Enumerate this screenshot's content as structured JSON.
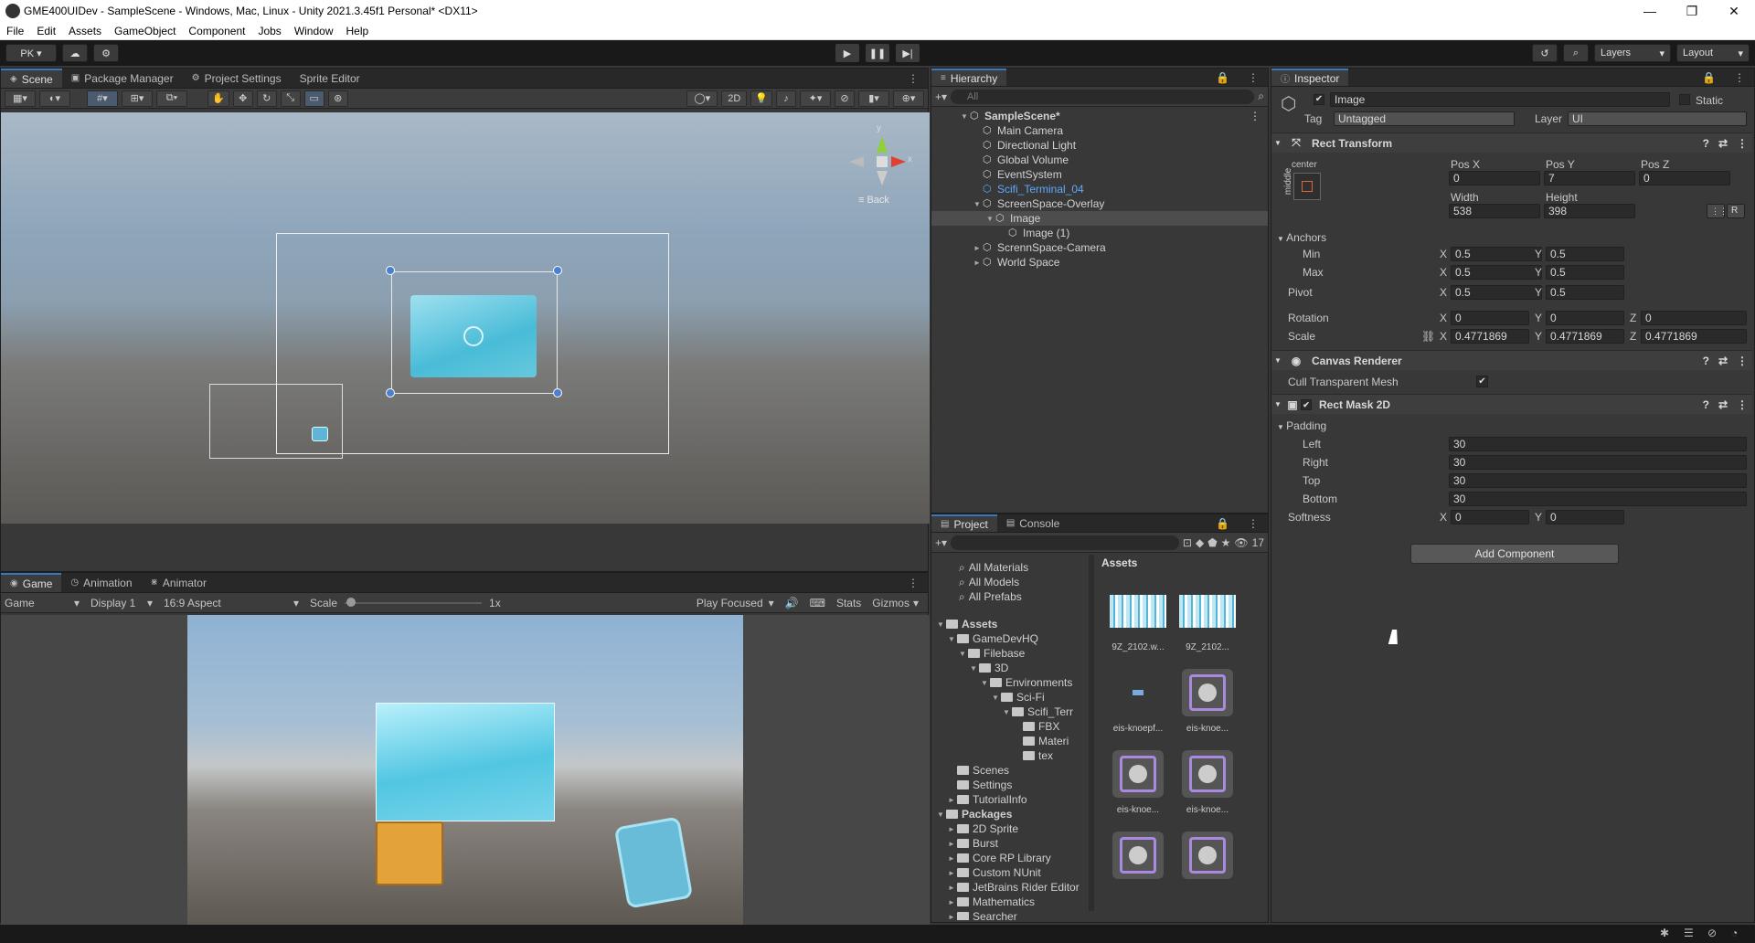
{
  "window": {
    "title": "GME400UIDev - SampleScene - Windows, Mac, Linux - Unity 2021.3.45f1 Personal* <DX11>",
    "minimize": "—",
    "maximize": "❐",
    "close": "✕"
  },
  "menu": [
    "File",
    "Edit",
    "Assets",
    "GameObject",
    "Component",
    "Jobs",
    "Window",
    "Help"
  ],
  "toolbar": {
    "account": "PK ▾",
    "play_icon": "play-icon",
    "layers": "Layers",
    "layout": "Layout"
  },
  "scene_tabs": {
    "scene": "Scene",
    "package_manager": "Package Manager",
    "project_settings": "Project Settings",
    "sprite_editor": "Sprite Editor"
  },
  "scene_toolbar": {
    "mode_2d": "2D"
  },
  "gizmo": {
    "y": "y",
    "x": "x",
    "back": "≡ Back"
  },
  "game_tabs": {
    "game": "Game",
    "animation": "Animation",
    "animator": "Animator"
  },
  "game_toolbar": {
    "game_select": "Game",
    "display": "Display 1",
    "aspect": "16:9 Aspect",
    "scale_label": "Scale",
    "scale_value": "1x",
    "play_focused": "Play Focused",
    "stats": "Stats",
    "gizmos": "Gizmos"
  },
  "hierarchy": {
    "tab": "Hierarchy",
    "search_placeholder": "All",
    "rows": [
      {
        "label": "SampleScene*",
        "depth": 0,
        "arrow": "▼",
        "bold": true
      },
      {
        "label": "Main Camera",
        "depth": 1,
        "arrow": ""
      },
      {
        "label": "Directional Light",
        "depth": 1,
        "arrow": ""
      },
      {
        "label": "Global Volume",
        "depth": 1,
        "arrow": ""
      },
      {
        "label": "EventSystem",
        "depth": 1,
        "arrow": ""
      },
      {
        "label": "Scifi_Terminal_04",
        "depth": 1,
        "arrow": "",
        "prefab": true
      },
      {
        "label": "ScreenSpace-Overlay",
        "depth": 1,
        "arrow": "▼"
      },
      {
        "label": "Image",
        "depth": 2,
        "arrow": "▼",
        "selected": true
      },
      {
        "label": "Image (1)",
        "depth": 3,
        "arrow": ""
      },
      {
        "label": "ScrennSpace-Camera",
        "depth": 1,
        "arrow": "►"
      },
      {
        "label": "World Space",
        "depth": 1,
        "arrow": "►"
      }
    ]
  },
  "project": {
    "tabs": {
      "project": "Project",
      "console": "Console"
    },
    "count": "17",
    "favorites": [
      "All Materials",
      "All Models",
      "All Prefabs"
    ],
    "tree": [
      {
        "label": "Assets",
        "depth": 0,
        "arrow": "▼",
        "bold": true
      },
      {
        "label": "GameDevHQ",
        "depth": 1,
        "arrow": "▼"
      },
      {
        "label": "Filebase",
        "depth": 2,
        "arrow": "▼"
      },
      {
        "label": "3D",
        "depth": 3,
        "arrow": "▼"
      },
      {
        "label": "Environments",
        "depth": 4,
        "arrow": "▼"
      },
      {
        "label": "Sci-Fi",
        "depth": 5,
        "arrow": "▼"
      },
      {
        "label": "Scifi_Terr",
        "depth": 6,
        "arrow": "▼"
      },
      {
        "label": "FBX",
        "depth": 7,
        "arrow": ""
      },
      {
        "label": "Materi",
        "depth": 7,
        "arrow": ""
      },
      {
        "label": "tex",
        "depth": 7,
        "arrow": ""
      },
      {
        "label": "Scenes",
        "depth": 1,
        "arrow": ""
      },
      {
        "label": "Settings",
        "depth": 1,
        "arrow": ""
      },
      {
        "label": "TutorialInfo",
        "depth": 1,
        "arrow": "►"
      },
      {
        "label": "Packages",
        "depth": 0,
        "arrow": "▼",
        "bold": true
      },
      {
        "label": "2D Sprite",
        "depth": 1,
        "arrow": "►"
      },
      {
        "label": "Burst",
        "depth": 1,
        "arrow": "►"
      },
      {
        "label": "Core RP Library",
        "depth": 1,
        "arrow": "►"
      },
      {
        "label": "Custom NUnit",
        "depth": 1,
        "arrow": "►"
      },
      {
        "label": "JetBrains Rider Editor",
        "depth": 1,
        "arrow": "►"
      },
      {
        "label": "Mathematics",
        "depth": 1,
        "arrow": "►"
      },
      {
        "label": "Searcher",
        "depth": 1,
        "arrow": "►"
      }
    ],
    "assets_header": "Assets",
    "assets": [
      {
        "label": "9Z_2102.w...",
        "kind": "texture"
      },
      {
        "label": "9Z_2102...",
        "kind": "texture"
      },
      {
        "label": "eis-knoepf...",
        "kind": "small"
      },
      {
        "label": "eis-knoe...",
        "kind": "knob"
      },
      {
        "label": "eis-knoe...",
        "kind": "knob"
      },
      {
        "label": "eis-knoe...",
        "kind": "knob"
      },
      {
        "label": "",
        "kind": "knob"
      },
      {
        "label": "",
        "kind": "knob"
      }
    ]
  },
  "inspector": {
    "tab": "Inspector",
    "object_name": "Image",
    "static_label": "Static",
    "tag_label": "Tag",
    "tag_value": "Untagged",
    "layer_label": "Layer",
    "layer_value": "UI",
    "rect_transform": {
      "title": "Rect Transform",
      "anchor_h": "center",
      "anchor_v": "middle",
      "pos_x_label": "Pos X",
      "pos_y_label": "Pos Y",
      "pos_z_label": "Pos Z",
      "pos_x": "0",
      "pos_y": "7",
      "pos_z": "0",
      "width_label": "Width",
      "height_label": "Height",
      "width": "538",
      "height": "398",
      "r_btn": "R",
      "anchors_label": "Anchors",
      "min_label": "Min",
      "max_label": "Max",
      "min_x": "0.5",
      "min_y": "0.5",
      "max_x": "0.5",
      "max_y": "0.5",
      "pivot_label": "Pivot",
      "pivot_x": "0.5",
      "pivot_y": "0.5",
      "rotation_label": "Rotation",
      "rot_x": "0",
      "rot_y": "0",
      "rot_z": "0",
      "scale_label": "Scale",
      "scale_x": "0.4771869",
      "scale_y": "0.4771869",
      "scale_z": "0.4771869",
      "x": "X",
      "y": "Y",
      "z": "Z"
    },
    "canvas_renderer": {
      "title": "Canvas Renderer",
      "cull_label": "Cull Transparent Mesh",
      "check": "✔"
    },
    "rect_mask": {
      "title": "Rect Mask 2D",
      "padding_label": "Padding",
      "left_label": "Left",
      "right_label": "Right",
      "top_label": "Top",
      "bottom_label": "Bottom",
      "left": "30",
      "right": "30",
      "top": "30",
      "bottom": "30",
      "softness_label": "Softness",
      "soft_x": "0",
      "soft_y": "0"
    },
    "add_component": "Add Component"
  },
  "colors": {
    "accent": "#3a79bb",
    "prefab_blue": "#5fa8ff",
    "selected_row": "#4d4d4d"
  }
}
